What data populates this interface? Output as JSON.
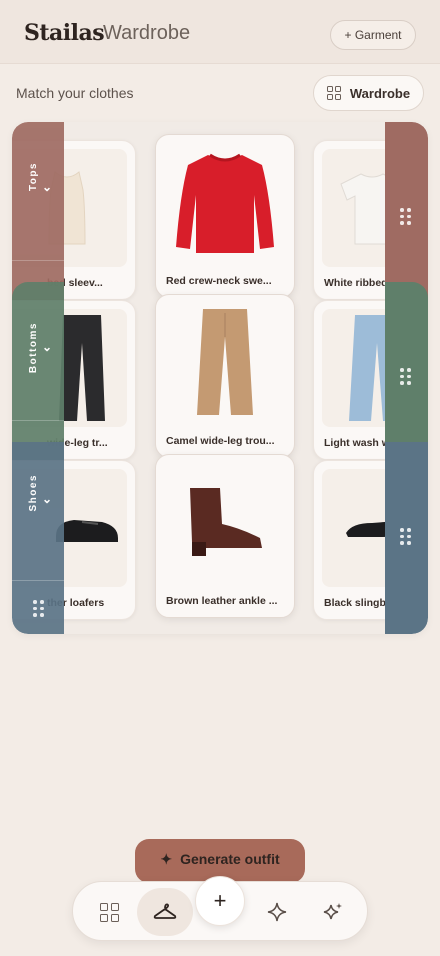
{
  "header": {
    "brand": "Stailas",
    "section": "Wardrobe",
    "garment_button": "+ Garment"
  },
  "subheader": {
    "title": "Match your clothes",
    "wardrobe_button": "Wardrobe"
  },
  "rows": [
    {
      "label": "Tops",
      "color": "#9f6b62",
      "items": [
        "Ribbed sleeveless top",
        "Red crew-neck sweater",
        "White ribbed tee"
      ],
      "visible_labels": [
        "bed sleev...",
        "Red crew-neck swe...",
        "White ribbed"
      ]
    },
    {
      "label": "Bottoms",
      "color": "#5f7f6a",
      "items": [
        "Black wide-leg trousers",
        "Camel wide-leg trousers",
        "Light wash wide jeans"
      ],
      "visible_labels": [
        "wide-leg tr...",
        "Camel wide-leg trou...",
        "Light wash w"
      ]
    },
    {
      "label": "Shoes",
      "color": "#5b7486",
      "items": [
        "Black leather loafers",
        "Brown leather ankle boots",
        "Black slingback flats"
      ],
      "visible_labels": [
        "ther loafers",
        "Brown leather ankle ...",
        "Black slingba"
      ]
    }
  ],
  "actions": {
    "generate": "Generate outfit",
    "generate_icon": "sparkle-icon"
  },
  "nav": {
    "items": [
      "grid-icon",
      "hanger-icon",
      "plus-icon",
      "sparkle-outline-icon",
      "sparkles-icon"
    ],
    "add_symbol": "+",
    "active": "hanger-icon"
  }
}
